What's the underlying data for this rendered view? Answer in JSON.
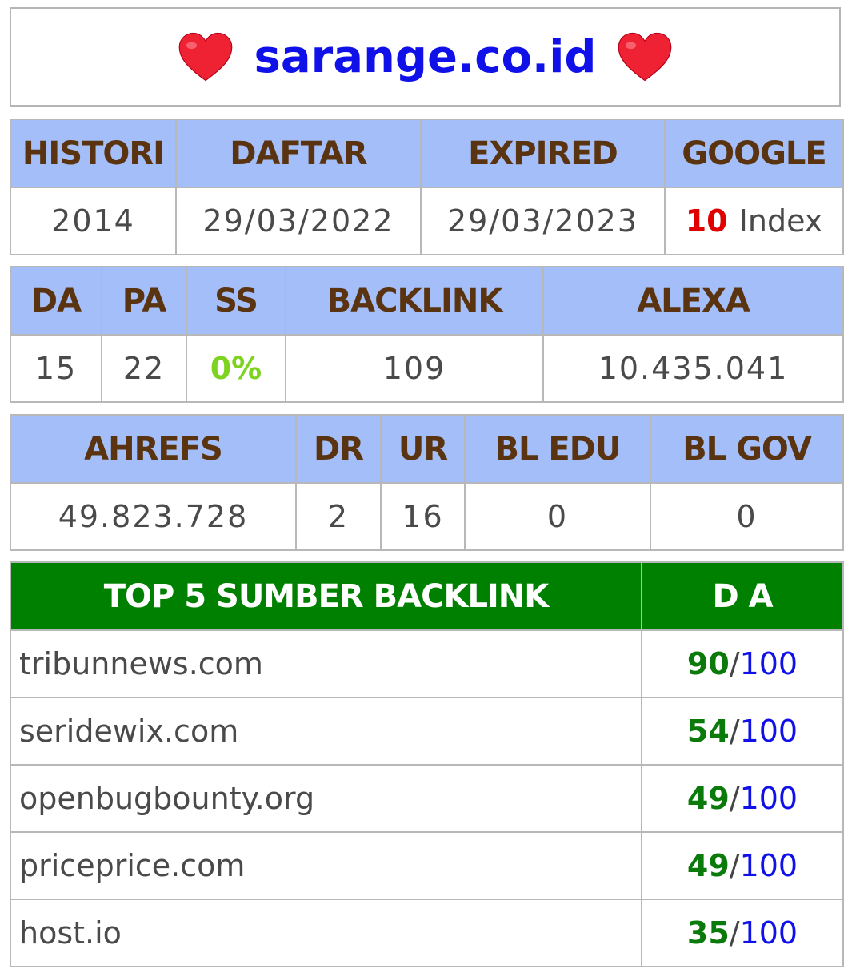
{
  "header": {
    "site": "sarange.co.id",
    "icon": "heart-icon",
    "heart_color": "#ee2233"
  },
  "table1": {
    "headers": [
      "HISTORI",
      "DAFTAR",
      "EXPIRED",
      "GOOGLE"
    ],
    "values": {
      "histori": "2014",
      "daftar": "29/03/2022",
      "expired": "29/03/2023",
      "google_count": "10",
      "google_label": "Index"
    }
  },
  "table2": {
    "headers": [
      "DA",
      "PA",
      "SS",
      "BACKLINK",
      "ALEXA"
    ],
    "values": [
      "15",
      "22",
      "0%",
      "109",
      "10.435.041"
    ]
  },
  "table3": {
    "headers": [
      "AHREFS",
      "DR",
      "UR",
      "BL EDU",
      "BL GOV"
    ],
    "values": [
      "49.823.728",
      "2",
      "16",
      "0",
      "0"
    ]
  },
  "table4": {
    "headers": [
      "TOP 5 SUMBER BACKLINK",
      "D A"
    ],
    "rows": [
      {
        "source": "tribunnews.com",
        "da": "90",
        "sep": "/",
        "max": "100"
      },
      {
        "source": "seridewix.com",
        "da": "54",
        "sep": "/",
        "max": "100"
      },
      {
        "source": "openbugbounty.org",
        "da": "49",
        "sep": "/",
        "max": "100"
      },
      {
        "source": "priceprice.com",
        "da": "49",
        "sep": "/",
        "max": "100"
      },
      {
        "source": "host.io",
        "da": "35",
        "sep": "/",
        "max": "100"
      }
    ]
  },
  "colors": {
    "site": "#1010e8",
    "header_bg": "#a4bef9",
    "header_text": "#5a3410",
    "green_header": "#008000",
    "da_green": "#0a7a0a",
    "red": "#e00000",
    "lime": "#7ed321"
  }
}
